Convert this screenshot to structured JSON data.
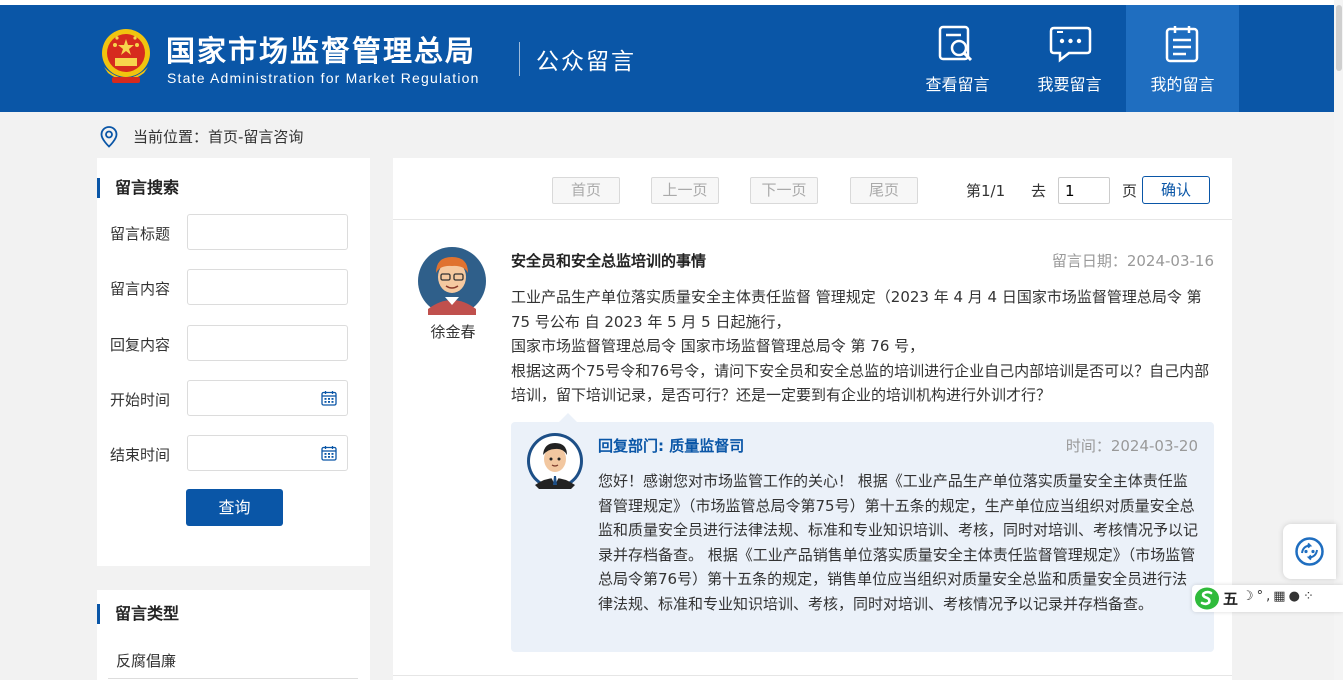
{
  "header": {
    "logo_cn": "国家市场监督管理总局",
    "logo_en": "State Administration for Market Regulation",
    "section_title": "公众留言",
    "nav": [
      {
        "label": "查看留言",
        "icon": "search-message-icon",
        "active": false
      },
      {
        "label": "我要留言",
        "icon": "chat-bubble-icon",
        "active": false
      },
      {
        "label": "我的留言",
        "icon": "clipboard-list-icon",
        "active": true
      }
    ],
    "colors": {
      "brand": "#0a56a7",
      "active_nav": "#1f6ec0"
    }
  },
  "breadcrumb": {
    "text": "当前位置：首页-留言咨询"
  },
  "search": {
    "title": "留言搜索",
    "fields": [
      {
        "label": "留言标题",
        "value": ""
      },
      {
        "label": "留言内容",
        "value": ""
      },
      {
        "label": "回复内容",
        "value": ""
      },
      {
        "label": "开始时间",
        "value": ""
      },
      {
        "label": "结束时间",
        "value": ""
      }
    ],
    "button": "查询"
  },
  "types": {
    "title": "留言类型",
    "items": [
      "反腐倡廉"
    ]
  },
  "pager": {
    "first": "首页",
    "prev": "上一页",
    "next": "下一页",
    "last": "尾页",
    "status": "第1/1",
    "goto_prefix": "去",
    "page_value": "1",
    "goto_suffix": "页",
    "confirm": "确认"
  },
  "message": {
    "user": "徐金春",
    "title": "安全员和安全总监培训的事情",
    "date": "留言日期：2024-03-16",
    "body": [
      "工业产品生产单位落实质量安全主体责任监督 管理规定（2023 年 4 月 4 日国家市场监督管理总局令 第 75 号公布 自 2023 年 5 月 5 日起施行，",
      "国家市场监督管理总局令 国家市场监督管理总局令 第 76 号，",
      "根据这两个75号令和76号令，请问下安全员和安全总监的培训进行企业自己内部培训是否可以？自己内部培训，留下培训记录，是否可行？还是一定要到有企业的培训机构进行外训才行？"
    ]
  },
  "reply": {
    "dept": "回复部门: 质量监督司",
    "date": "时间：2024-03-20",
    "body": "您好！感谢您对市场监管工作的关心！ 根据《工业产品生产单位落实质量安全主体责任监督管理规定》（市场监管总局令第75号）第十五条的规定，生产单位应当组织对质量安全总监和质量安全员进行法律法规、标准和专业知识培训、考核，同时对培训、考核情况予以记录并存档备查。 根据《工业产品销售单位落实质量安全主体责任监督管理规定》（市场监管总局令第76号）第十五条的规定，销售单位应当组织对质量安全总监和质量安全员进行法律法规、标准和专业知识培训、考核，同时对培训、考核情况予以记录并存档备查。"
  },
  "ime": {
    "wu": "五"
  }
}
